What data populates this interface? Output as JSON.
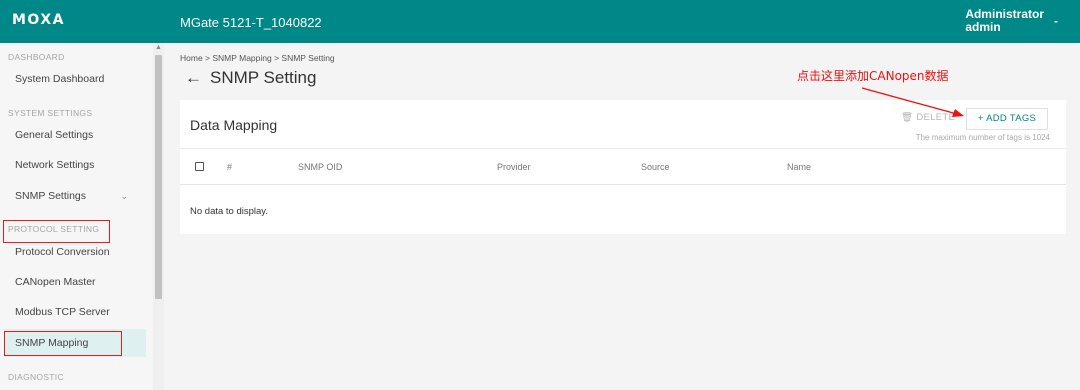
{
  "header": {
    "logo": "MOXA",
    "device_name": "MGate 5121-T_1040822",
    "user_role": "Administrator",
    "user_name": "admin",
    "caret": "-"
  },
  "sidebar": {
    "sections": [
      {
        "label": "DASHBOARD"
      },
      {
        "label": "SYSTEM SETTINGS"
      },
      {
        "label": "PROTOCOL SETTING"
      },
      {
        "label": "DIAGNOSTIC"
      }
    ],
    "items": [
      {
        "label": "System Dashboard"
      },
      {
        "label": "General Settings"
      },
      {
        "label": "Network Settings"
      },
      {
        "label": "SNMP Settings"
      },
      {
        "label": "Protocol Conversion"
      },
      {
        "label": "CANopen Master"
      },
      {
        "label": "Modbus TCP Server"
      },
      {
        "label": "SNMP Mapping"
      }
    ]
  },
  "breadcrumb": "Home > SNMP Mapping > SNMP Setting",
  "page_title": "SNMP Setting",
  "card": {
    "title": "Data Mapping",
    "delete_label": "DELETE",
    "add_label": "+ ADD TAGS",
    "max_note": "The maximum number of tags is 1024",
    "columns": [
      "#",
      "SNMP OID",
      "Provider",
      "Source",
      "Name"
    ],
    "empty_text": "No data to display."
  },
  "annotation": "点击这里添加CANopen数据",
  "colors": {
    "primary": "#008787",
    "annotation_red": "#f01010",
    "active_item_bg": "#dff0f0"
  }
}
